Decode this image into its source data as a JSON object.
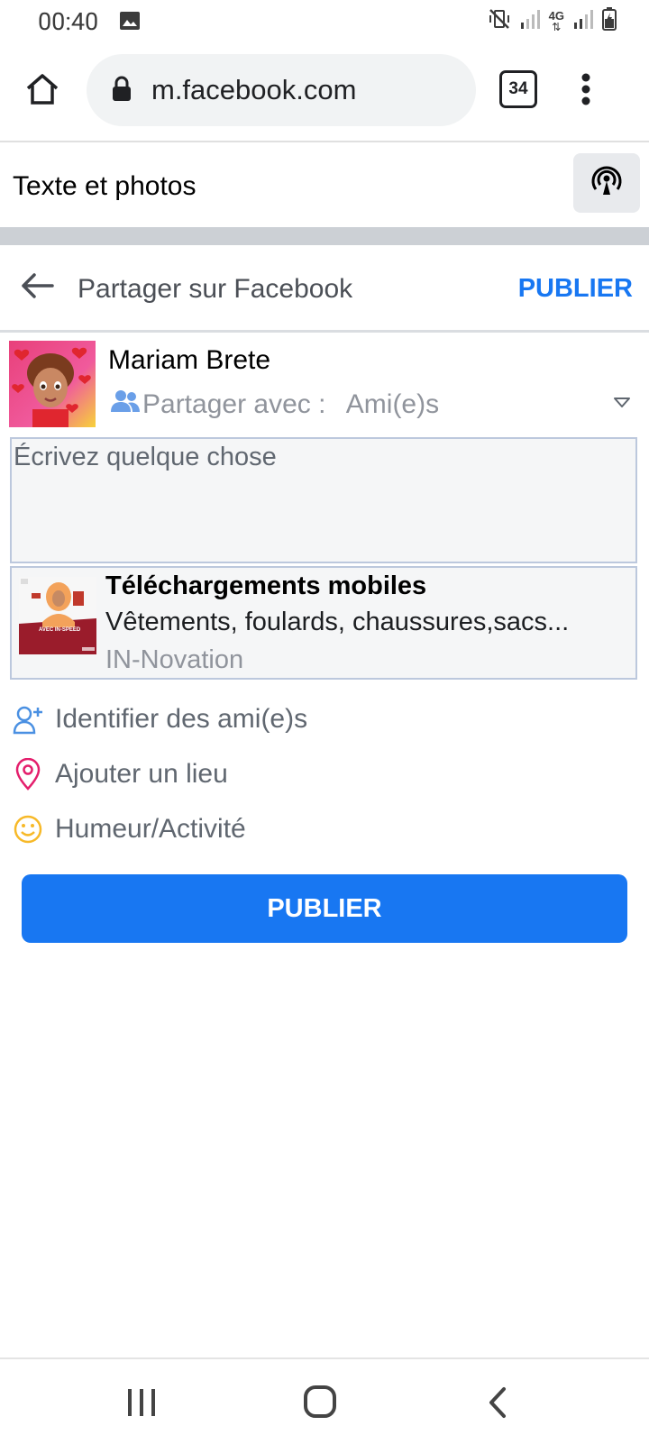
{
  "status": {
    "time": "00:40",
    "network": "4G"
  },
  "browser": {
    "url": "m.facebook.com",
    "tab_count": "34"
  },
  "lite_bar": {
    "title": "Texte et photos"
  },
  "share": {
    "title": "Partager sur Facebook",
    "publish_link": "PUBLIER",
    "user_name": "Mariam Brete",
    "audience_prefix": "Partager avec : ",
    "audience_value": "Ami(e)s",
    "composer_placeholder": "Écrivez quelque chose",
    "preview": {
      "title": "Téléchargements mobiles",
      "description": "Vêtements, foulards, chaussures,sacs...",
      "source": "IN-Novation",
      "thumb_text": "AVEC IN-SPEED"
    },
    "actions": [
      {
        "label": "Identifier des ami(e)s",
        "icon": "tag-friends-icon"
      },
      {
        "label": "Ajouter un lieu",
        "icon": "location-pin-icon"
      },
      {
        "label": "Humeur/Activité",
        "icon": "smiley-icon"
      }
    ],
    "publish_button": "PUBLIER"
  },
  "colors": {
    "accent": "#1877f2",
    "pin": "#e41e6c",
    "smiley": "#f7b928"
  }
}
